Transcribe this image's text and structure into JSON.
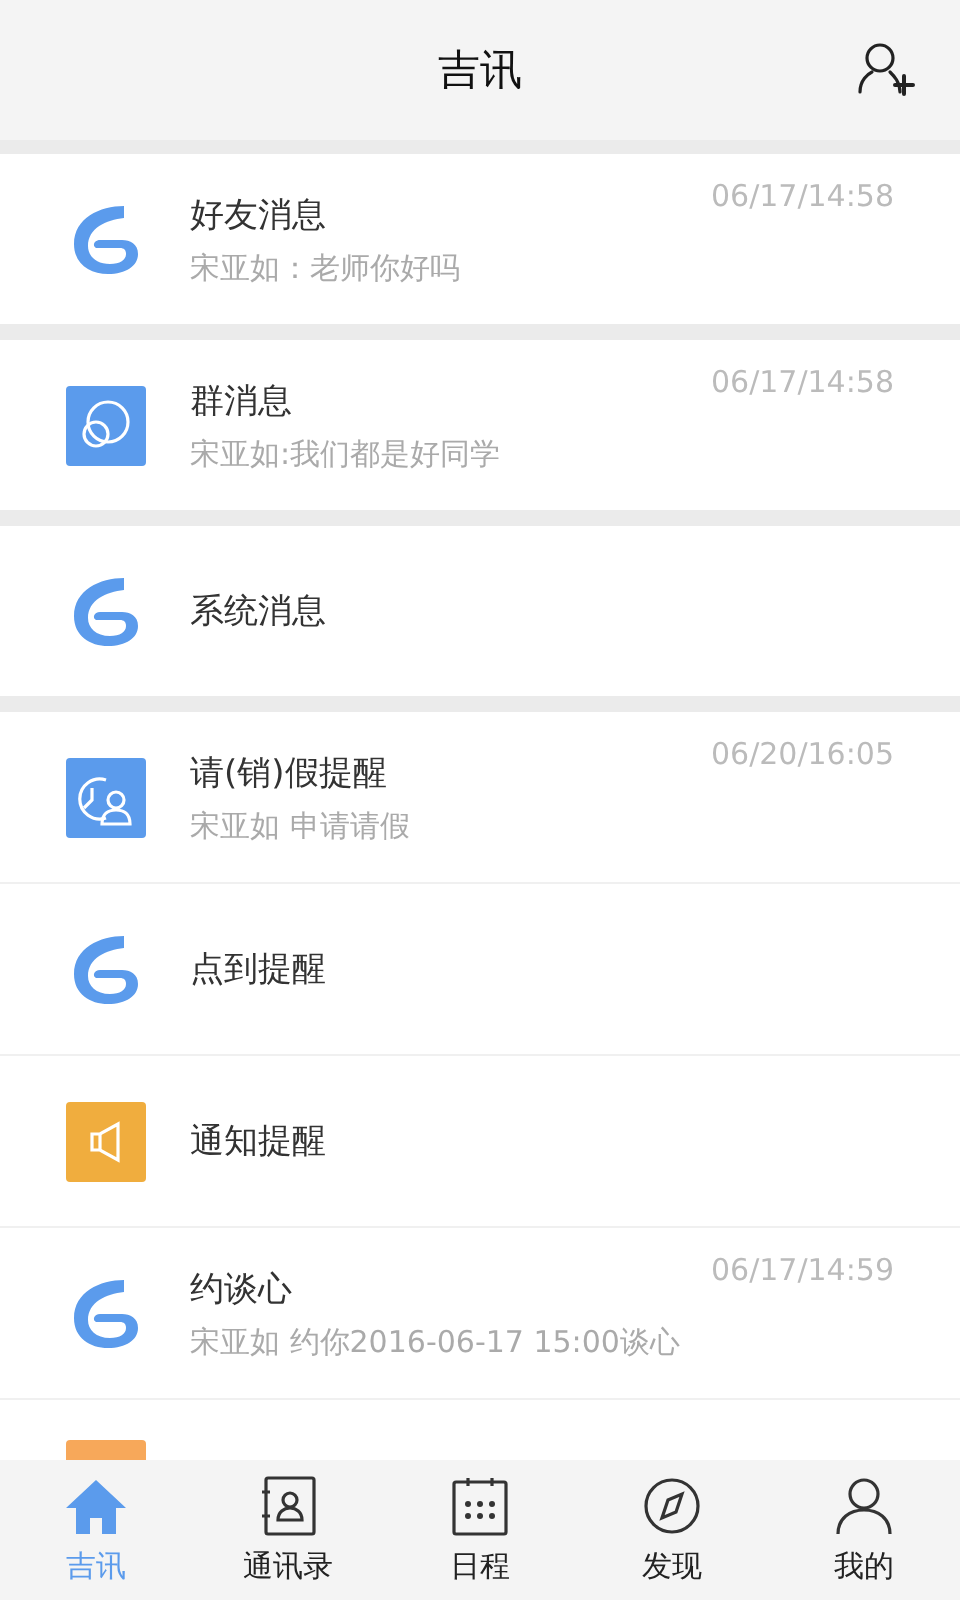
{
  "header": {
    "title": "吉讯"
  },
  "sections": [
    {
      "items": [
        {
          "kind": "logo",
          "title": "好友消息",
          "subtitle": "宋亚如：老师你好吗",
          "time": "06/17/14:58"
        }
      ]
    },
    {
      "items": [
        {
          "kind": "group",
          "title": "群消息",
          "subtitle": "宋亚如:我们都是好同学",
          "time": "06/17/14:58"
        }
      ]
    },
    {
      "items": [
        {
          "kind": "logo",
          "title": "系统消息"
        }
      ]
    },
    {
      "items": [
        {
          "kind": "leave",
          "title": "请(销)假提醒",
          "subtitle": "宋亚如 申请请假",
          "time": "06/20/16:05"
        },
        {
          "kind": "logo",
          "title": "点到提醒"
        },
        {
          "kind": "notice",
          "title": "通知提醒"
        },
        {
          "kind": "logo",
          "title": "约谈心",
          "subtitle": "宋亚如 约你2016-06-17 15:00谈心",
          "time": "06/17/14:59"
        },
        {
          "kind": "partial"
        }
      ]
    }
  ],
  "tabs": [
    {
      "label": "吉讯",
      "selected": true
    },
    {
      "label": "通讯录",
      "selected": false
    },
    {
      "label": "日程",
      "selected": false
    },
    {
      "label": "发现",
      "selected": false
    },
    {
      "label": "我的",
      "selected": false
    }
  ]
}
